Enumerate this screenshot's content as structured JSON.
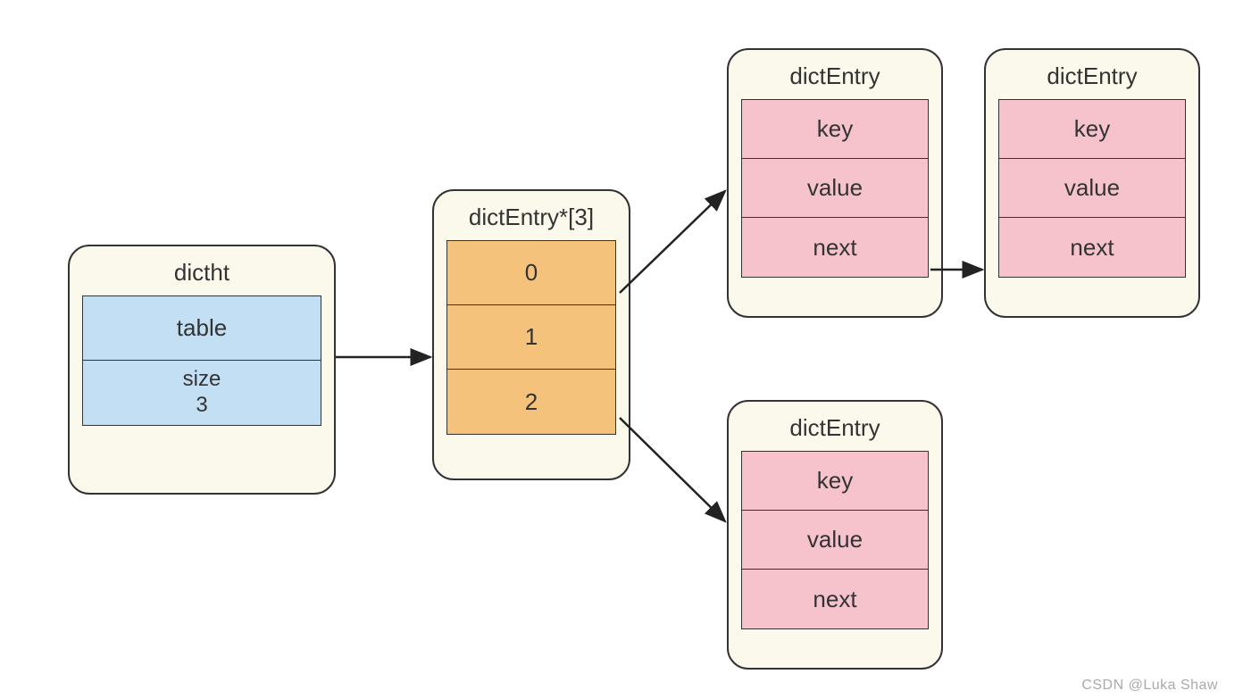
{
  "dictht": {
    "title": "dictht",
    "rows": [
      {
        "label": "table"
      },
      {
        "label": "size",
        "sub": "3"
      }
    ]
  },
  "dictEntryArray": {
    "title": "dictEntry*[3]",
    "rows": [
      {
        "label": "0"
      },
      {
        "label": "1"
      },
      {
        "label": "2"
      }
    ]
  },
  "dictEntryA": {
    "title": "dictEntry",
    "rows": [
      {
        "label": "key"
      },
      {
        "label": "value"
      },
      {
        "label": "next"
      }
    ]
  },
  "dictEntryB": {
    "title": "dictEntry",
    "rows": [
      {
        "label": "key"
      },
      {
        "label": "value"
      },
      {
        "label": "next"
      }
    ]
  },
  "dictEntryC": {
    "title": "dictEntry",
    "rows": [
      {
        "label": "key"
      },
      {
        "label": "value"
      },
      {
        "label": "next"
      }
    ]
  },
  "watermark": "CSDN @Luka Shaw"
}
